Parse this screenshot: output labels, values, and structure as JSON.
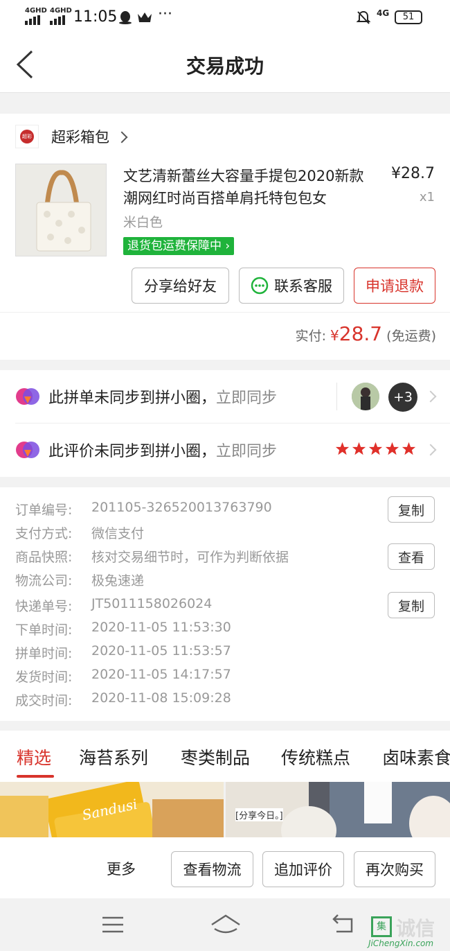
{
  "status_bar": {
    "time": "11:05",
    "signal1": "4GHD",
    "signal2": "4GHD",
    "net": "4G",
    "battery": "51"
  },
  "nav": {
    "title": "交易成功"
  },
  "shop": {
    "name": "超彩箱包",
    "logo_text": "超彩"
  },
  "product": {
    "title": "文艺清新蕾丝大容量手提包2020新款潮网红时尚百搭单肩托特包包女",
    "price": "¥28.7",
    "qty": "x1",
    "variant": "米白色",
    "badge": "退货包运费保障中"
  },
  "actions": {
    "share": "分享给好友",
    "contact": "联系客服",
    "refund": "申请退款"
  },
  "payment": {
    "label": "实付:",
    "currency": "¥",
    "amount": "28.7",
    "shipping": "(免运费)"
  },
  "sync": {
    "row1_text": "此拼单未同步到拼小圈，",
    "row1_link": "立即同步",
    "row1_badge": "+3",
    "row2_text": "此评价未同步到拼小圈，",
    "row2_link": "立即同步",
    "rating": 5
  },
  "order_info": [
    {
      "label": "订单编号:",
      "value": "201105-326520013763790",
      "button": "复制"
    },
    {
      "label": "支付方式:",
      "value": "微信支付"
    },
    {
      "label": "商品快照:",
      "value": "核对交易细节时，可作为判断依据",
      "button": "查看"
    },
    {
      "label": "物流公司:",
      "value": "极兔速递"
    },
    {
      "label": "快递单号:",
      "value": "JT5011158026024",
      "button": "复制"
    },
    {
      "label": "下单时间:",
      "value": "2020-11-05 11:53:30"
    },
    {
      "label": "拼单时间:",
      "value": "2020-11-05 11:53:57"
    },
    {
      "label": "发货时间:",
      "value": "2020-11-05 14:17:57"
    },
    {
      "label": "成交时间:",
      "value": "2020-11-08 15:09:28"
    }
  ],
  "tabs": [
    "精选",
    "海苔系列",
    "枣类制品",
    "传统糕点",
    "卤味素食"
  ],
  "reco": {
    "img1_text": "Sandusi",
    "img2_text": "[分享今日。]"
  },
  "bottom": {
    "more": "更多",
    "logistics": "查看物流",
    "review": "追加评价",
    "rebuy": "再次购买"
  },
  "watermark": {
    "brand": "诚信",
    "url": "JiChengXin.com"
  },
  "colors": {
    "accent": "#d8342c",
    "green": "#1fb33b",
    "star": "#e0302a"
  }
}
